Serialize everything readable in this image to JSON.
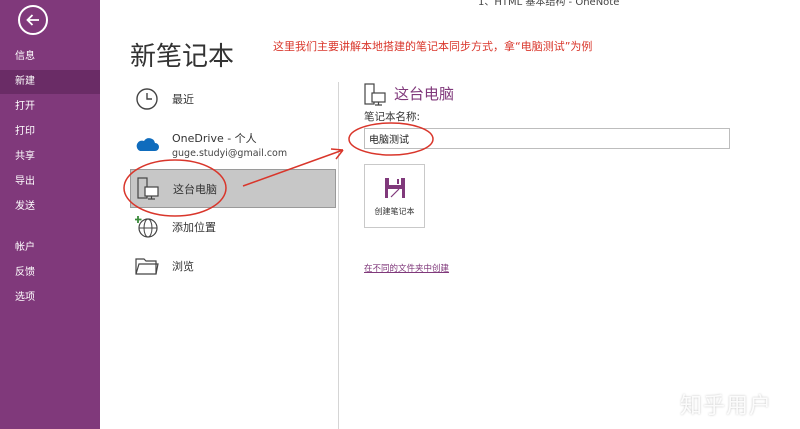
{
  "window": {
    "title": "1、HTML 基本结构 - OneNote"
  },
  "sidebar": {
    "items": [
      {
        "label": "信息"
      },
      {
        "label": "新建"
      },
      {
        "label": "打开"
      },
      {
        "label": "打印"
      },
      {
        "label": "共享"
      },
      {
        "label": "导出"
      },
      {
        "label": "发送"
      },
      {
        "label": "帐户"
      },
      {
        "label": "反馈"
      },
      {
        "label": "选项"
      }
    ],
    "active": "新建"
  },
  "main": {
    "title": "新笔记本",
    "annotation": "这里我们主要讲解本地搭建的笔记本同步方式，拿“电脑测试”为例",
    "locations": [
      {
        "label": "最近",
        "icon": "clock-icon"
      },
      {
        "label": "OneDrive - 个人",
        "sub": "guge.studyi@gmail.com",
        "icon": "cloud-icon"
      },
      {
        "label": "这台电脑",
        "icon": "computer-icon",
        "selected": true
      },
      {
        "label": "添加位置",
        "icon": "globe-add-icon"
      },
      {
        "label": "浏览",
        "icon": "folder-icon"
      }
    ]
  },
  "detail": {
    "title": "这台电脑",
    "name_label": "笔记本名称:",
    "name_value": "电脑测试",
    "create_label": "创建笔记本",
    "different_folder": "在不同的文件夹中创建"
  },
  "colors": {
    "accent": "#80397b",
    "annotation": "#d9362b",
    "selected": "#c7c7c7"
  },
  "watermark": "知乎用户"
}
